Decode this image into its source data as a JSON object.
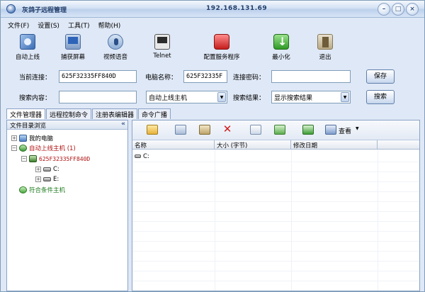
{
  "window": {
    "title": "灰鸽子远程管理",
    "ip": "192.168.131.69"
  },
  "menu": [
    "文件(F)",
    "设置(S)",
    "工具(T)",
    "帮助(H)"
  ],
  "toolbar": [
    {
      "label": "自动上线",
      "icon": "network-icon"
    },
    {
      "label": "捕获屏幕",
      "icon": "screen-capture-icon"
    },
    {
      "label": "视频语音",
      "icon": "video-voice-icon"
    },
    {
      "label": "Telnet",
      "icon": "telnet-icon"
    },
    {
      "label": "配置服务程序",
      "icon": "service-config-icon"
    },
    {
      "label": "最小化",
      "icon": "minimize-icon"
    },
    {
      "label": "退出",
      "icon": "exit-icon"
    }
  ],
  "connection": {
    "current_label": "当前连接：",
    "current_value": "625F32335FF840D",
    "computer_label": "电脑名称：",
    "computer_value": "625F32335F",
    "password_label": "连接密码：",
    "password_value": "",
    "save_label": "保存"
  },
  "search": {
    "content_label": "搜索内容：",
    "content_value": "",
    "scope_value": "自动上线主机",
    "result_label": "搜索结果：",
    "result_value": "显示搜索结果",
    "search_label": "搜索"
  },
  "tabs": [
    "文件管理器",
    "远程控制命令",
    "注册表编辑器",
    "命令广播"
  ],
  "tree": {
    "header": "文件目录浏览",
    "collapse": "«",
    "items": {
      "my_computer": "我的电脑",
      "online_hosts": "自动上线主机 (1)",
      "host": "625F32335FF840D",
      "drive_c": "C:",
      "drive_e": "E:",
      "matching_hosts": "符合条件主机"
    }
  },
  "file_toolbar": {
    "view_label": "查看"
  },
  "file_list": {
    "columns": [
      "名称",
      "大小 (字节)",
      "修改日期"
    ],
    "rows": [
      {
        "name": "C:"
      }
    ]
  }
}
